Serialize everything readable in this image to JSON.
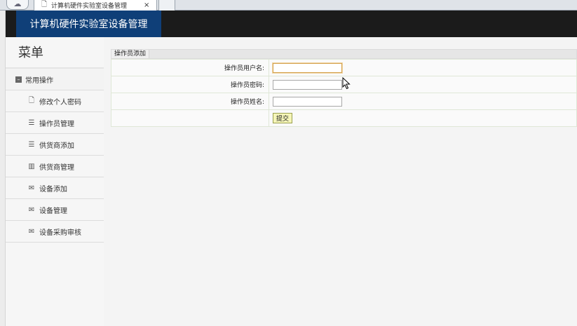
{
  "browser": {
    "tab_title": "计算机硬件实验室设备管理",
    "tab_close": "×",
    "home_icon": "cloud-icon"
  },
  "header": {
    "title": "计算机硬件实验室设备管理",
    "bg_color": "#1b1b1b",
    "title_bg_color": "#0f3f78"
  },
  "sidebar": {
    "menu_title": "菜单",
    "group_label": "常用操作",
    "items": [
      {
        "label": "修改个人密码",
        "icon": "document-icon"
      },
      {
        "label": "操作员管理",
        "icon": "list-icon"
      },
      {
        "label": "供货商添加",
        "icon": "list-icon"
      },
      {
        "label": "供货商管理",
        "icon": "chart-icon"
      },
      {
        "label": "设备添加",
        "icon": "mail-icon"
      },
      {
        "label": "设备管理",
        "icon": "mail-icon"
      },
      {
        "label": "设备采购审核",
        "icon": "mail-icon"
      }
    ]
  },
  "form": {
    "header_tab": "操作员添加",
    "username_label": "操作员用户名:",
    "username_value": "",
    "password_label": "操作员密码:",
    "password_value": "",
    "name_label": "操作员姓名:",
    "name_value": "",
    "submit_label": "提交"
  }
}
